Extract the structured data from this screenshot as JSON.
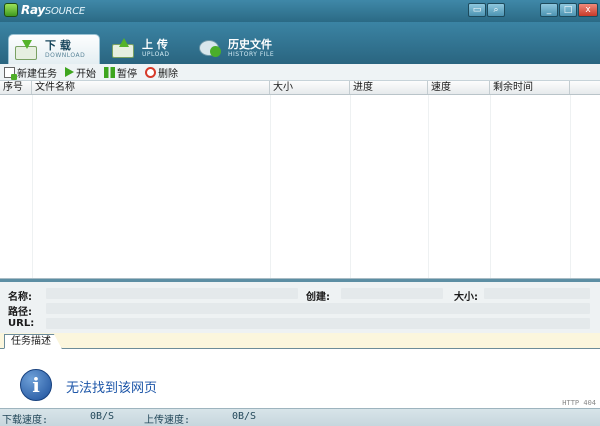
{
  "app": {
    "logo_main": "Ray",
    "logo_sub": "SOURCE"
  },
  "window_controls": {
    "min": "_",
    "max": "□",
    "close": "x"
  },
  "tabs": [
    {
      "cn": "下  载",
      "en": "DOWNLOAD",
      "icon": "download-icon"
    },
    {
      "cn": "上  传",
      "en": "UPLOAD",
      "icon": "upload-icon"
    },
    {
      "cn": "历史文件",
      "en": "HISTORY FILE",
      "icon": "history-icon"
    }
  ],
  "toolbar": {
    "new_task": "新建任务",
    "start": "开始",
    "pause": "暂停",
    "delete": "删除"
  },
  "table": {
    "columns": [
      "序号",
      "文件名称",
      "大小",
      "进度",
      "速度",
      "剩余时间"
    ]
  },
  "info": {
    "name_label": "名称:",
    "created_label": "创建:",
    "size_label": "大小:",
    "path_label": "路径:",
    "url_label": "URL:"
  },
  "desc": {
    "tab_label": "任务描述"
  },
  "content": {
    "error_text": "无法找到该网页",
    "error_code": "HTTP 404"
  },
  "status": {
    "download_label": "下载速度:",
    "download_value": "0B/S",
    "upload_label": "上传速度:",
    "upload_value": "0B/S"
  },
  "colors": {
    "accent": "#2f6d86",
    "tab_active": "#fdfefe",
    "error_blue": "#1d56a8"
  }
}
